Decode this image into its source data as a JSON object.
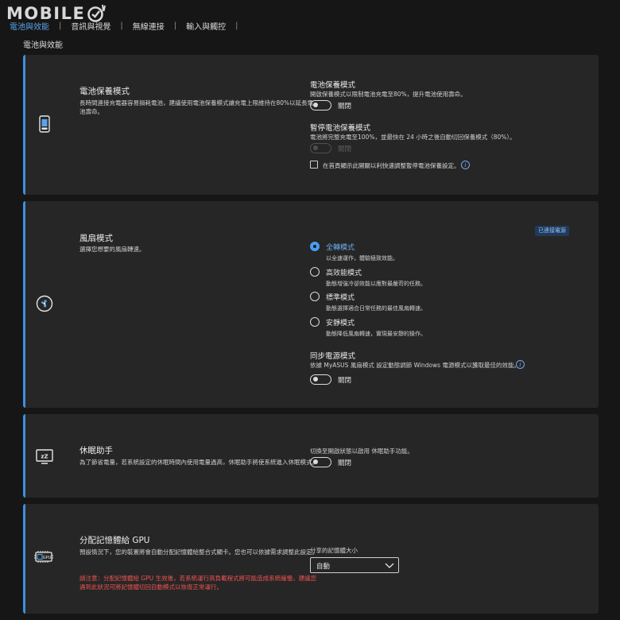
{
  "brand": {
    "logo_text": "MOBILE",
    "accent_color": "#3d8fe0"
  },
  "tabs": [
    {
      "label": "電池與效能",
      "active": true
    },
    {
      "label": "音訊與視覺",
      "active": false
    },
    {
      "label": "無線連接",
      "active": false
    },
    {
      "label": "輸入與觸控",
      "active": false
    }
  ],
  "tab_separator": "|",
  "page_title": "電池與效能",
  "battery": {
    "icon": "battery-icon",
    "title": "電池保養模式",
    "description": "長時間連接充電器容易損耗電池，建議使用電池保養模式讓充電上限維持在80%以延長電池壽命。",
    "care_mode": {
      "title": "電池保養模式",
      "description": "開啟保養模式以限制電池充電至80%，提升電池使用壽命。",
      "toggle_state": "off",
      "toggle_label": "關閉"
    },
    "pause_mode": {
      "title": "暫停電池保養模式",
      "description": "電池將完整充電至100%，並最快在 24 小時之後自動切回保養模式（80%）。",
      "toggle_state": "off",
      "toggle_label": "關閉",
      "disabled": true
    },
    "shortcut_checkbox": {
      "label": "在首頁顯示此開關以利快速調整暫停電池保養設定。",
      "checked": false
    }
  },
  "fan": {
    "icon": "fan-icon",
    "title": "風扇模式",
    "description": "選擇您想要的風扇轉速。",
    "badge": "已連接電源",
    "options": [
      {
        "label": "全轉模式",
        "description": "以全速運作，體驗極致效能。",
        "selected": true
      },
      {
        "label": "高效能模式",
        "description": "動態增強冷卻效能以應對最嚴苛的任務。",
        "selected": false
      },
      {
        "label": "標準模式",
        "description": "動態選擇適合日常任務的最佳風扇轉速。",
        "selected": false
      },
      {
        "label": "安靜模式",
        "description": "動態降低風扇轉速，實現最安靜的操作。",
        "selected": false
      }
    ],
    "sync": {
      "title": "同步電源模式",
      "description": "依據 MyASUS 風扇模式 設定動態調節 Windows 電源模式以獲取最佳的效能。",
      "toggle_state": "off",
      "toggle_label": "關閉"
    }
  },
  "sleep": {
    "icon": "sleep-monitor-icon",
    "icon_text": "zZ",
    "title": "休眠助手",
    "description": "為了節省電量，若系統設定的休眠時間內使用電量過高，休眠助手將使系統進入休眠模式。",
    "toggle_description": "切換至開啟狀態以啟用 休眠助手功能。",
    "toggle_state": "off",
    "toggle_label": "關閉"
  },
  "gpu_memory": {
    "icon": "gpu-memory-icon",
    "icon_text": "GPU",
    "title": "分配記憶體給 GPU",
    "description": "預設情況下，您的裝置將會自動分配記憶體給整合式顯卡。您也可以依據需求調整此設定。",
    "warning": "請注意：分配記憶體給 GPU 生效後，若系統運行高負載程式將可能造成系統緩慢，建議您遇到此狀況可將記憶體切回自動模式以恢復正常運行。",
    "select_label": "分享的記憶體大小",
    "select_value": "自動"
  },
  "colors": {
    "background": "#161616",
    "card": "#262626",
    "accent": "#3d8fe0",
    "warning": "#ef5350",
    "active_tab": "#5aa3ea"
  }
}
